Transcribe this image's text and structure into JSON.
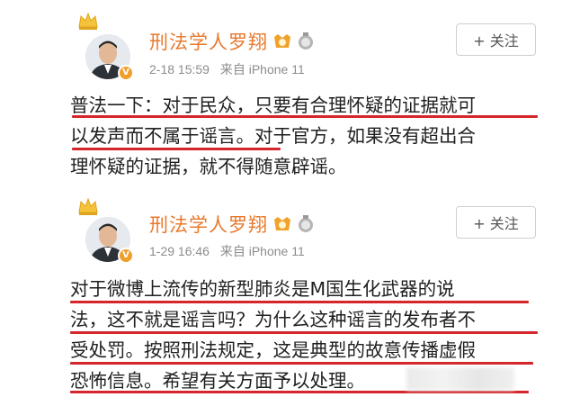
{
  "posts": [
    {
      "username": "刑法学人罗翔",
      "timestamp": "2-18 15:59",
      "source": "来自 iPhone 11",
      "follow_label": "+ 关注",
      "body_lines": [
        "普法一下：对于民众，只要有合理怀疑的证据就可",
        "以发声而不属于谣言。对于官方，如果没有超出合",
        "理怀疑的证据，就不得随意辟谣。"
      ]
    },
    {
      "username": "刑法学人罗翔",
      "timestamp": "1-29 16:46",
      "source": "来自 iPhone 11",
      "follow_label": "+ 关注",
      "body_lines": [
        "对于微博上流传的新型肺炎是M国生化武器的说",
        "法，这不就是谣言吗？为什么这种谣言的发布者不",
        "受处罚。按照刑法规定，这是典型的故意传播虚假",
        "恐怖信息。希望有关方面予以处理。"
      ]
    }
  ],
  "icons": {
    "crown": "crown-icon",
    "verified": "verified-v-icon",
    "gold_badge": "gold-medal-icon",
    "silver_badge": "silver-medal-icon"
  },
  "verified_mark": "V",
  "colors": {
    "username": "#e8792c",
    "highlight_underline": "#d4262b",
    "meta_text": "#8c8c8c",
    "verified_badge": "#f0a02a"
  }
}
